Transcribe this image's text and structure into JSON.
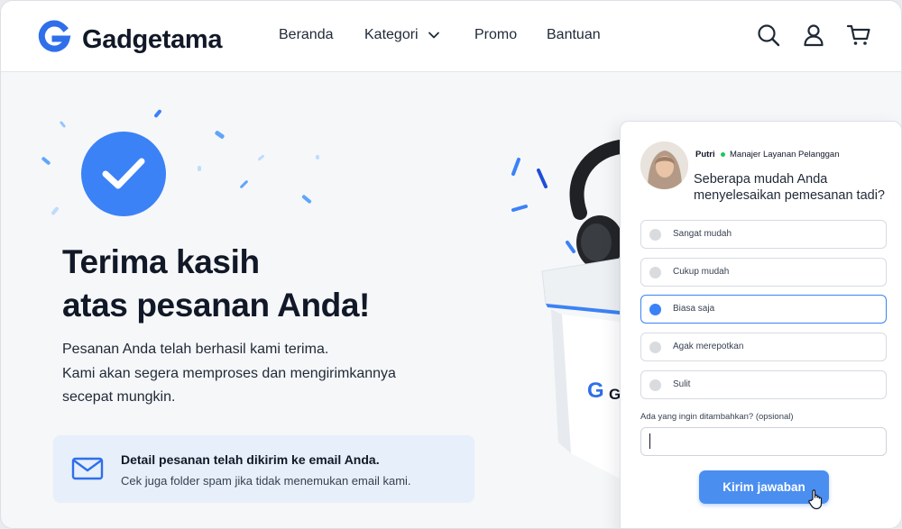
{
  "header": {
    "brand": "Gadgetama",
    "nav": {
      "beranda": "Beranda",
      "kategori": "Kategori",
      "promo": "Promo",
      "bantuan": "Bantuan"
    },
    "icons": [
      "search-icon",
      "user-icon",
      "cart-icon"
    ]
  },
  "hero": {
    "title_line1": "Terima kasih",
    "title_line2": "atas pesanan Anda!",
    "desc_line1": "Pesanan Anda telah berhasil kami terima.",
    "desc_line2": "Kami akan segera memproses dan mengirimkannya",
    "desc_line3": "secepat mungkin."
  },
  "email_notice": {
    "title": "Detail pesanan telah dikirim ke email Anda.",
    "subtitle": "Cek juga folder spam jika tidak menemukan email kami."
  },
  "product_box": {
    "logo_text": "G"
  },
  "survey": {
    "agent_name": "Putri",
    "agent_role": "Manajer Layanan Pelanggan",
    "question_line1": "Seberapa mudah Anda",
    "question_line2": "menyelesaikan pemesanan tadi?",
    "options": [
      {
        "label": "Sangat mudah",
        "selected": false
      },
      {
        "label": "Cukup mudah",
        "selected": false
      },
      {
        "label": "Biasa saja",
        "selected": true
      },
      {
        "label": "Agak merepotkan",
        "selected": false
      },
      {
        "label": "Sulit",
        "selected": false
      }
    ],
    "extra_label": "Ada yang ingin ditambahkan? (opsional)",
    "extra_value": "",
    "submit_label": "Kirim jawaban"
  },
  "colors": {
    "accent": "#3b82f6",
    "online": "#22c55e",
    "notice_bg": "#e7effa"
  }
}
